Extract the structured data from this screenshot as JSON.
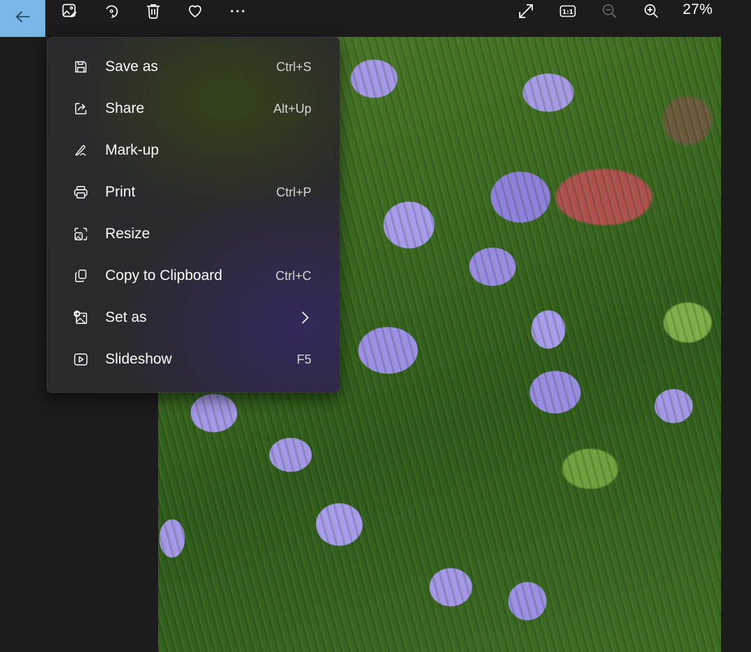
{
  "toolbar": {
    "back_icon": "arrow-left-icon",
    "actions": [
      {
        "name": "edit-image",
        "icon": "image-edit-icon"
      },
      {
        "name": "rotate",
        "icon": "rotate-icon"
      },
      {
        "name": "delete",
        "icon": "trash-icon"
      },
      {
        "name": "favorite",
        "icon": "heart-icon"
      },
      {
        "name": "more",
        "icon": "more-horizontal-icon"
      }
    ],
    "view_actions": [
      {
        "name": "full-screen",
        "icon": "expand-icon"
      },
      {
        "name": "actual-size",
        "icon": "one-to-one-icon",
        "label": "1:1"
      },
      {
        "name": "zoom-out",
        "icon": "zoom-out-icon",
        "disabled": true
      },
      {
        "name": "zoom-in",
        "icon": "zoom-in-icon"
      }
    ],
    "zoom_level": "27%"
  },
  "menu": {
    "items": [
      {
        "label": "Save as",
        "shortcut": "Ctrl+S",
        "icon": "save-icon"
      },
      {
        "label": "Share",
        "shortcut": "Alt+Up",
        "icon": "share-icon"
      },
      {
        "label": "Mark-up",
        "shortcut": "",
        "icon": "markup-pen-icon"
      },
      {
        "label": "Print",
        "shortcut": "Ctrl+P",
        "icon": "printer-icon"
      },
      {
        "label": "Resize",
        "shortcut": "",
        "icon": "resize-image-icon"
      },
      {
        "label": "Copy to Clipboard",
        "shortcut": "Ctrl+C",
        "icon": "copy-icon"
      },
      {
        "label": "Set as",
        "shortcut": "",
        "icon": "set-as-image-icon",
        "submenu": true
      },
      {
        "label": "Slideshow",
        "shortcut": "F5",
        "icon": "slideshow-icon"
      }
    ]
  },
  "photo": {
    "subject": "purple bellflowers with green foliage"
  },
  "colors": {
    "back_button_bg": "#78b7e6",
    "app_bg": "#1c1c1c",
    "zoom_out_disabled": "#6b6b6b"
  }
}
